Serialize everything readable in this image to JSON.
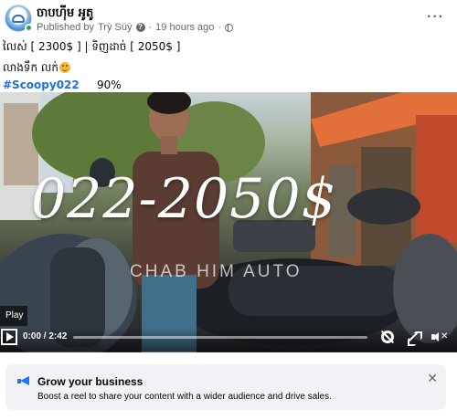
{
  "post": {
    "page_name": "ចាបហ៊ីម អូតូ",
    "published_by_label": "Published by",
    "author": "Trỳ Süỳ",
    "time": "19 hours ago",
    "meta_separator": "·",
    "more_label": "···"
  },
  "caption": {
    "line1": "លៃស់  [ 2300$ ]   |  ទិញដាច់   [ 2050$ ]",
    "line2": "លាងទឹក លក់",
    "hashtag": "#Scoopy022",
    "percent": "90%"
  },
  "video": {
    "overlay_text": "022-2050$",
    "watermark": "CHAB HIM AUTO",
    "play_tooltip": "Play",
    "time_display": "0:00 / 2:42",
    "progress": 0,
    "mute_mark": "✕"
  },
  "promo": {
    "title": "Grow your business",
    "text": "Boost a reel to share your content with a wider audience and drive sales.",
    "close_label": "✕"
  },
  "colors": {
    "link_blue": "#216fdb",
    "accent": "#1877f2",
    "meta_gray": "#65676b",
    "online_green": "#31a24c"
  }
}
